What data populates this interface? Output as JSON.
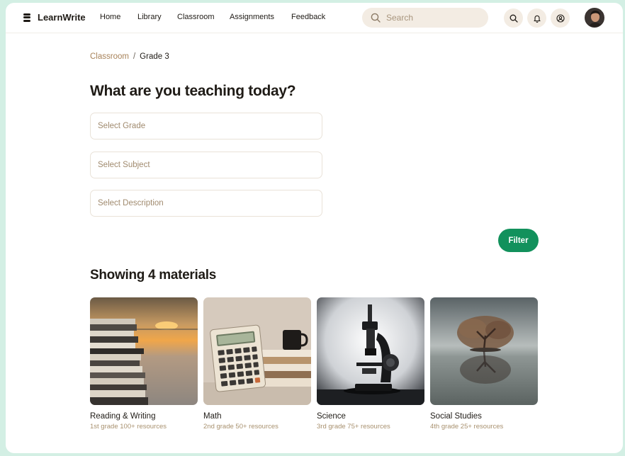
{
  "app": {
    "name": "LearnWrite"
  },
  "nav": {
    "links": [
      "Home",
      "Library",
      "Classroom",
      "Assignments",
      "Feedback"
    ],
    "search_placeholder": "Search",
    "icons": [
      "search-icon",
      "bell-icon",
      "user-circle-icon"
    ]
  },
  "breadcrumb": {
    "parent": "Classroom",
    "separator": "/",
    "current": "Grade 3"
  },
  "main": {
    "title": "What are you teaching today?",
    "fields": {
      "grade": "Select Grade",
      "subject": "Select Subject",
      "description": "Select Description"
    },
    "filter_label": "Filter",
    "results_title": "Showing 4 materials"
  },
  "materials": [
    {
      "title": "Reading & Writing",
      "meta": "1st grade 100+ resources",
      "image": "stacked-books-sunset"
    },
    {
      "title": "Math",
      "meta": "2nd grade 50+ resources",
      "image": "calculator-books-mug"
    },
    {
      "title": "Science",
      "meta": "3rd grade 75+ resources",
      "image": "microscope"
    },
    {
      "title": "Social Studies",
      "meta": "4th grade 25+ resources",
      "image": "tree-on-water"
    }
  ],
  "colors": {
    "background": "#d3efe4",
    "accent": "#12915c",
    "muted_text": "#a8835a",
    "search_bg": "#f3ece3"
  }
}
